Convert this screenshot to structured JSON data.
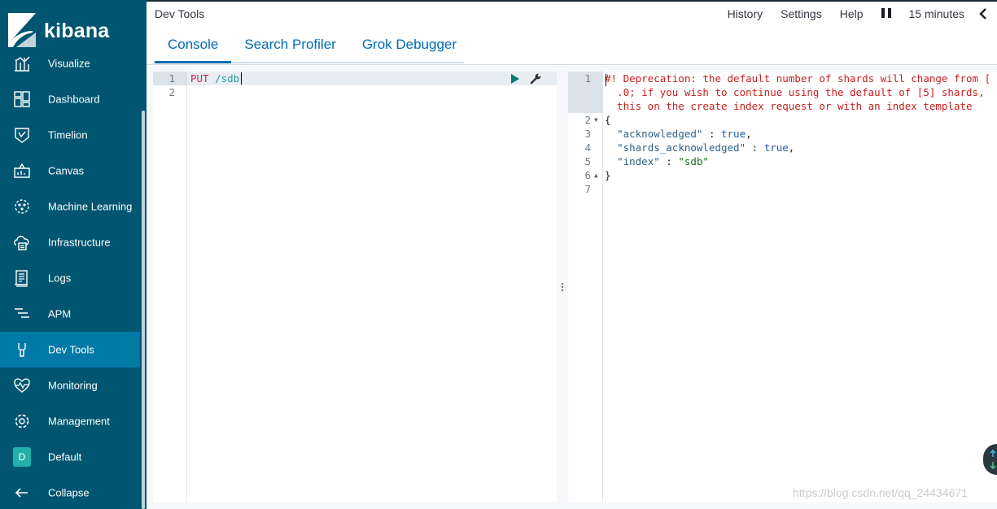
{
  "brand": {
    "name": "kibana"
  },
  "sidebar": {
    "items": [
      {
        "label": "Visualize",
        "icon": "visualize-icon"
      },
      {
        "label": "Dashboard",
        "icon": "dashboard-icon"
      },
      {
        "label": "Timelion",
        "icon": "timelion-icon"
      },
      {
        "label": "Canvas",
        "icon": "canvas-icon"
      },
      {
        "label": "Machine Learning",
        "icon": "machine-learning-icon"
      },
      {
        "label": "Infrastructure",
        "icon": "infrastructure-icon"
      },
      {
        "label": "Logs",
        "icon": "logs-icon"
      },
      {
        "label": "APM",
        "icon": "apm-icon"
      },
      {
        "label": "Dev Tools",
        "icon": "dev-tools-icon",
        "active": true
      },
      {
        "label": "Monitoring",
        "icon": "monitoring-icon"
      },
      {
        "label": "Management",
        "icon": "management-icon"
      },
      {
        "label": "Default",
        "icon": "space-badge",
        "badge": "D"
      },
      {
        "label": "Collapse",
        "icon": "collapse-arrow-icon"
      }
    ]
  },
  "header": {
    "breadcrumb": "Dev Tools",
    "history": "History",
    "settings": "Settings",
    "help": "Help",
    "time": "15 minutes"
  },
  "tabs": [
    {
      "label": "Console",
      "active": true
    },
    {
      "label": "Search Profiler"
    },
    {
      "label": "Grok Debugger"
    }
  ],
  "request_editor": {
    "line_numbers": [
      "1",
      "2"
    ],
    "method": "PUT",
    "path": " /sdb"
  },
  "response_editor": {
    "line_numbers": [
      "1",
      "2",
      "3",
      "4",
      "5",
      "6",
      "7"
    ],
    "warning_lines": [
      "#! Deprecation: the default number of shards will change from [",
      "  .0; if you wish to continue using the default of [5] shards,",
      "  this on the create index request or with an index template"
    ],
    "open_brace": "{",
    "close_brace": "}",
    "fields": [
      {
        "key": "\"acknowledged\"",
        "sep": " : ",
        "value": "true",
        "kind": "bool",
        "trail": ","
      },
      {
        "key": "\"shards_acknowledged\"",
        "sep": " : ",
        "value": "true",
        "kind": "bool",
        "trail": ","
      },
      {
        "key": "\"index\"",
        "sep": " : ",
        "value": "\"sdb\"",
        "kind": "str",
        "trail": ""
      }
    ]
  },
  "watermark": "https://blog.csdn.net/qq_24434671",
  "colors": {
    "sidebar": "#005571",
    "active": "#0079a5",
    "link": "#006bb4"
  }
}
